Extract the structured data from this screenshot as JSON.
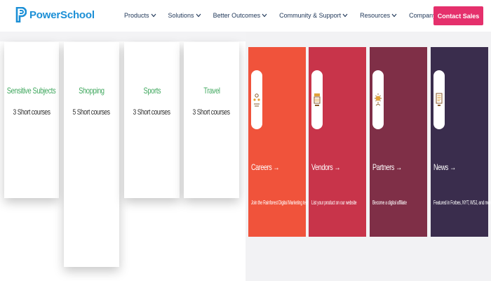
{
  "header": {
    "logo_text": "PowerSchool",
    "nav": [
      {
        "label": "Products"
      },
      {
        "label": "Solutions"
      },
      {
        "label": "Better Outcomes"
      },
      {
        "label": "Community & Support"
      },
      {
        "label": "Resources"
      },
      {
        "label": "Company"
      }
    ],
    "contact_label": "Contact Sales"
  },
  "categories": [
    {
      "title": "Sensitive Subjects",
      "count": "3 Short courses"
    },
    {
      "title": "Shopping",
      "count": "5 Short courses"
    },
    {
      "title": "Sports",
      "count": "3 Short courses"
    },
    {
      "title": "Travel",
      "count": "3 Short courses"
    }
  ],
  "promos": [
    {
      "title": "Careers →",
      "desc": "Join the Rainforest Digital Marketing team in Atlanta",
      "color": "#f0533b",
      "icon": "careers-icon"
    },
    {
      "title": "Vendors →",
      "desc": "List your product on our website",
      "color": "#c8344a",
      "icon": "vendors-icon"
    },
    {
      "title": "Partners →",
      "desc": "Become a digital affiliate",
      "color": "#7f2f47",
      "icon": "partners-icon"
    },
    {
      "title": "News →",
      "desc": "Featured in Forbes, NYT, WSJ, and more",
      "color": "#3a2d4d",
      "icon": "news-icon"
    }
  ],
  "colors": {
    "brand_blue": "#1b8fd6",
    "contact_pink": "#e5306c",
    "category_green": "#41a85f"
  }
}
